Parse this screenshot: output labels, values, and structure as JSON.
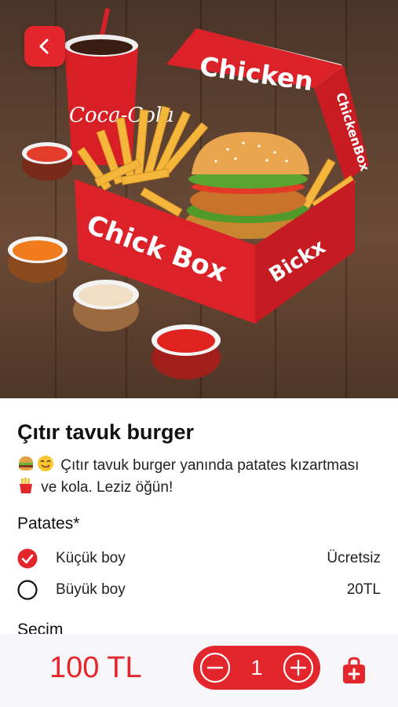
{
  "product": {
    "title": "Çıtır tavuk burger",
    "desc_part1": "Çıtır tavuk burger yanında patates kızartması",
    "desc_part2": "ve kola. Leziz öğün!",
    "image_texts": {
      "box_lid": "Chicken",
      "box_side": "ChickenBox",
      "box_front": "Chick Box",
      "box_end": "Bickx",
      "cup_brand": "Coca-Cola"
    }
  },
  "options": {
    "section_title": "Patates*",
    "items": [
      {
        "label": "Küçük boy",
        "price": "Ücretsiz",
        "selected": true
      },
      {
        "label": "Büyük boy",
        "price": "20TL",
        "selected": false
      }
    ],
    "next_section_title": "Seçim"
  },
  "footer": {
    "price": "100 TL",
    "quantity": "1"
  },
  "colors": {
    "accent": "#e3262c"
  },
  "icons": {
    "back": "chevron-left-icon",
    "minus": "minus-icon",
    "plus": "plus-icon",
    "cart": "shopping-bag-plus-icon"
  }
}
